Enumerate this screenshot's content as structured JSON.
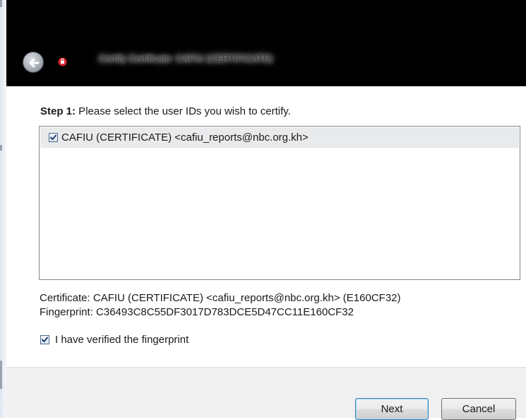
{
  "window": {
    "title": "Certify Certificate: CAFIU (CERTIFICATE)"
  },
  "step": {
    "label": "Step 1:",
    "text": " Please select the user IDs you wish to certify."
  },
  "user_ids": [
    {
      "label": "CAFIU (CERTIFICATE) <cafiu_reports@nbc.org.kh>",
      "checked": true
    }
  ],
  "certificate": {
    "line": "Certificate: CAFIU (CERTIFICATE) <cafiu_reports@nbc.org.kh> (E160CF32)",
    "fingerprint": "Fingerprint: C36493C8C55DF3017D783DCE5D47CC11E160CF32"
  },
  "verify": {
    "label": "I have verified the fingerprint",
    "checked": true
  },
  "buttons": {
    "next": "Next",
    "cancel": "Cancel"
  },
  "icons": {
    "back": "back-arrow-icon",
    "app": "kleopatra-app-icon",
    "check": "checkmark-icon"
  }
}
